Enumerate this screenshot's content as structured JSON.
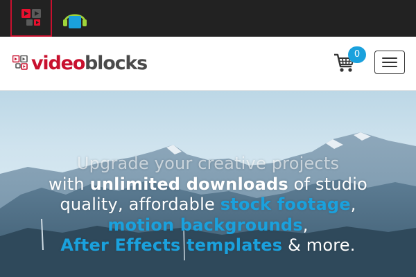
{
  "site_switcher": {
    "tabs": [
      {
        "name": "videoblocks",
        "icon": "videoblocks-icon",
        "active": true
      },
      {
        "name": "audioblocks",
        "icon": "headphones-icon",
        "active": false
      }
    ]
  },
  "navbar": {
    "logo": {
      "video": "video",
      "blocks": "blocks"
    },
    "cart": {
      "icon": "cart-icon",
      "count": "0"
    },
    "menu": {
      "icon": "hamburger-icon"
    }
  },
  "hero": {
    "line1": "Upgrade your creative projects",
    "line2_pre": "with ",
    "line2_bold": "unlimited downloads",
    "line2_post": " of studio",
    "line3_pre": "quality, affordable ",
    "line3_link": "stock footage",
    "line3_post": ",",
    "line4_link": "motion backgrounds",
    "line4_post": ",",
    "line5_link": "After Effects templates",
    "line5_post": " & more."
  },
  "colors": {
    "brand_red": "#c8102e",
    "accent_blue": "#1aa1dd",
    "topbar_bg": "#222222"
  }
}
